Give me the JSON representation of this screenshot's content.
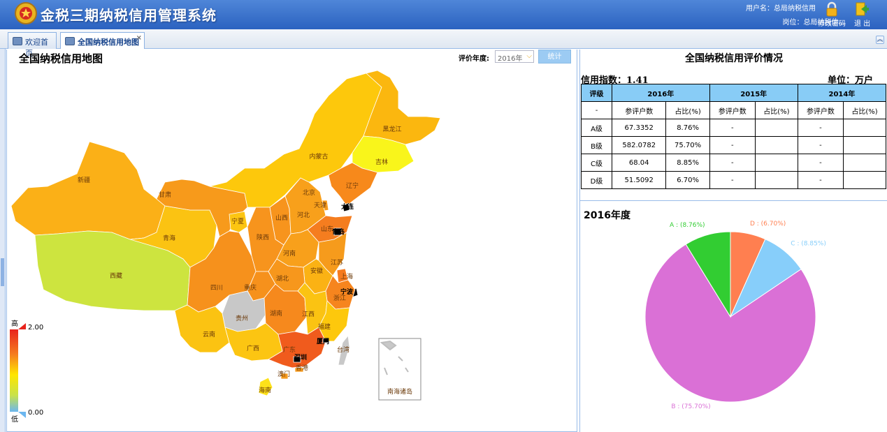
{
  "header": {
    "system_title": "金税三期纳税信用管理系统",
    "user_text": "用户名：总局纳税信用",
    "post_text": "岗位：总局纳税信...",
    "change_password": "修改密码",
    "exit": "退 出"
  },
  "tabs": [
    {
      "label": "欢迎首页",
      "active": false
    },
    {
      "label": "全国纳税信用地图",
      "active": true,
      "close": "×"
    }
  ],
  "map": {
    "title": "全国纳税信用地图",
    "year_label": "评价年度:",
    "year_value": "2016年",
    "stat_button": "统计",
    "legend": {
      "high_label": "高",
      "low_label": "低",
      "max": "2.00",
      "min": "0.00"
    },
    "colors": {
      "high": "#e8231c",
      "mid_high": "#f57c1f",
      "mid": "#fbb017",
      "low_mid": "#ffe600",
      "low": "#c8e24a",
      "none": "#c8c8c8"
    },
    "provinces": [
      {
        "name": "新疆",
        "color": "#fbb017"
      },
      {
        "name": "西藏",
        "color": "#cde43f"
      },
      {
        "name": "青海",
        "color": "#fbc312"
      },
      {
        "name": "甘肃",
        "color": "#f79a1b"
      },
      {
        "name": "内蒙古",
        "color": "#fdc80c"
      },
      {
        "name": "黑龙江",
        "color": "#fbb70f"
      },
      {
        "name": "吉林",
        "color": "#f9f51b"
      },
      {
        "name": "辽宁",
        "color": "#f7891b"
      },
      {
        "name": "北京",
        "color": "#ee5a22"
      },
      {
        "name": "天津",
        "color": "#f69a1e"
      },
      {
        "name": "大连",
        "color": "#000000"
      },
      {
        "name": "宁夏",
        "color": "#fcc512"
      },
      {
        "name": "山西",
        "color": "#f7941d"
      },
      {
        "name": "河北",
        "color": "#f8a01b"
      },
      {
        "name": "山东",
        "color": "#f57d1f"
      },
      {
        "name": "青岛",
        "color": "#000000"
      },
      {
        "name": "陕西",
        "color": "#f7941d"
      },
      {
        "name": "河南",
        "color": "#f8a01b"
      },
      {
        "name": "江苏",
        "color": "#f69b1c"
      },
      {
        "name": "安徽",
        "color": "#fbb214"
      },
      {
        "name": "上海",
        "color": "#f57a1f"
      },
      {
        "name": "四川",
        "color": "#f6911c"
      },
      {
        "name": "重庆",
        "color": "#f6911c"
      },
      {
        "name": "湖北",
        "color": "#f7971c"
      },
      {
        "name": "宁波",
        "color": "#000000"
      },
      {
        "name": "浙江",
        "color": "#f6851e"
      },
      {
        "name": "贵州",
        "color": "#c8c8c8"
      },
      {
        "name": "湖南",
        "color": "#f6891d"
      },
      {
        "name": "江西",
        "color": "#fbc312"
      },
      {
        "name": "福建",
        "color": "#fdc80c"
      },
      {
        "name": "云南",
        "color": "#fbc312"
      },
      {
        "name": "广西",
        "color": "#fcc512"
      },
      {
        "name": "广东",
        "color": "#f05b1d"
      },
      {
        "name": "厦门",
        "color": "#000000"
      },
      {
        "name": "深圳",
        "color": "#000000"
      },
      {
        "name": "台湾",
        "color": "#c8c8c8"
      },
      {
        "name": "澳门",
        "color": "#f59a1e"
      },
      {
        "name": "香港",
        "color": "#f59a1e"
      },
      {
        "name": "海南",
        "color": "#fde11a"
      },
      {
        "name": "南海诸岛",
        "color": "#c8c8c8"
      }
    ]
  },
  "credit_table": {
    "title": "全国纳税信用评价情况",
    "index_text": "信用指数：1.41",
    "unit_text": "单位：万户",
    "header": [
      "评级",
      "2016年",
      "2015年",
      "2014年"
    ],
    "subheader": [
      "-",
      "参评户数",
      "占比(%)",
      "参评户数",
      "占比(%)",
      "参评户数",
      "占比(%)"
    ],
    "rows": [
      [
        "A级",
        "67.3352",
        "8.76%",
        "-",
        "",
        "-",
        ""
      ],
      [
        "B级",
        "582.0782",
        "75.70%",
        "-",
        "",
        "-",
        ""
      ],
      [
        "C级",
        "68.04",
        "8.85%",
        "-",
        "",
        "-",
        ""
      ],
      [
        "D级",
        "51.5092",
        "6.70%",
        "-",
        "",
        "-",
        ""
      ]
    ]
  },
  "pie": {
    "title": "2016年度"
  },
  "chart_data": {
    "type": "pie",
    "slices": [
      {
        "label": "D : (6.70%)",
        "value": 6.7,
        "color": "#ff7f50"
      },
      {
        "label": "C : (8.85%)",
        "value": 8.85,
        "color": "#87cefa"
      },
      {
        "label": "B : (75.70%)",
        "value": 75.7,
        "color": "#da70d6"
      },
      {
        "label": "A : (8.76%)",
        "value": 8.76,
        "color": "#32cd32"
      }
    ]
  }
}
